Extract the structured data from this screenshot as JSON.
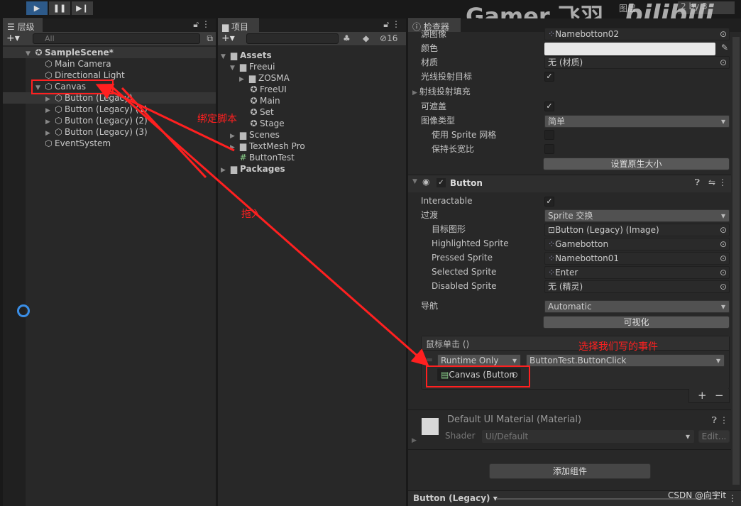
{
  "toolbar": {
    "play": "▶",
    "pause": "❚❚",
    "step": "▶❙",
    "layers": "图层",
    "layout": "2 by 3"
  },
  "watermark": {
    "gamer": "Gamer 飞羽",
    "bilibili": "bilibili",
    "csdn": "CSDN @向宇it"
  },
  "hierarchy": {
    "tab": "层级",
    "search_placeholder": "All",
    "scene": "SampleScene*",
    "items": [
      {
        "label": "Main Camera"
      },
      {
        "label": "Directional Light"
      },
      {
        "label": "Canvas"
      },
      {
        "label": "Button (Legacy)"
      },
      {
        "label": "Button (Legacy) (1)"
      },
      {
        "label": "Button (Legacy) (2)"
      },
      {
        "label": "Button (Legacy) (3)"
      },
      {
        "label": "EventSystem"
      }
    ]
  },
  "project": {
    "tab": "项目",
    "hidden_count": "16",
    "items": [
      {
        "label": "Assets"
      },
      {
        "label": "Freeui"
      },
      {
        "label": "ZOSMA"
      },
      {
        "label": "FreeUI"
      },
      {
        "label": "Main"
      },
      {
        "label": "Set"
      },
      {
        "label": "Stage"
      },
      {
        "label": "Scenes"
      },
      {
        "label": "TextMesh Pro"
      },
      {
        "label": "ButtonTest"
      },
      {
        "label": "Packages"
      }
    ]
  },
  "inspector": {
    "tab": "检查器",
    "image": {
      "source_label": "源图像",
      "source_value": "Namebotton02",
      "color_label": "颜色",
      "material_label": "材质",
      "material_value": "无 (材质)",
      "raycast_target_label": "光线投射目标",
      "raycast_padding_label": "射线投射填充",
      "maskable_label": "可遮盖",
      "image_type_label": "图像类型",
      "image_type_value": "简单",
      "use_sprite_mesh_label": "使用 Sprite 网格",
      "preserve_aspect_label": "保持长宽比",
      "set_native_size": "设置原生大小"
    },
    "button": {
      "title": "Button",
      "interactable_label": "Interactable",
      "transition_label": "过渡",
      "transition_value": "Sprite 交换",
      "target_graphic_label": "目标图形",
      "target_graphic_value": "Button (Legacy) (Image)",
      "highlighted_label": "Highlighted Sprite",
      "highlighted_value": "Gamebotton",
      "pressed_label": "Pressed Sprite",
      "pressed_value": "Namebotton01",
      "selected_label": "Selected Sprite",
      "selected_value": "Enter",
      "disabled_label": "Disabled Sprite",
      "disabled_value": "无 (精灵)",
      "navigation_label": "导航",
      "navigation_value": "Automatic",
      "visualize": "可视化",
      "onclick_label": "鼠标单击 ()",
      "runtime_value": "Runtime Only",
      "function_value": "ButtonTest.ButtonClick",
      "object_value": "Canvas (Button",
      "add": "+",
      "remove": "−"
    },
    "material": {
      "title": "Default UI Material (Material)",
      "shader_label": "Shader",
      "shader_value": "UI/Default",
      "edit": "Edit..."
    },
    "add_component": "添加组件",
    "footer": "Button (Legacy)"
  },
  "annotations": {
    "bind_script": "绑定脚本",
    "drag_in": "拖入",
    "select_event": "选择我们写的事件",
    "color": "#ff2020"
  }
}
